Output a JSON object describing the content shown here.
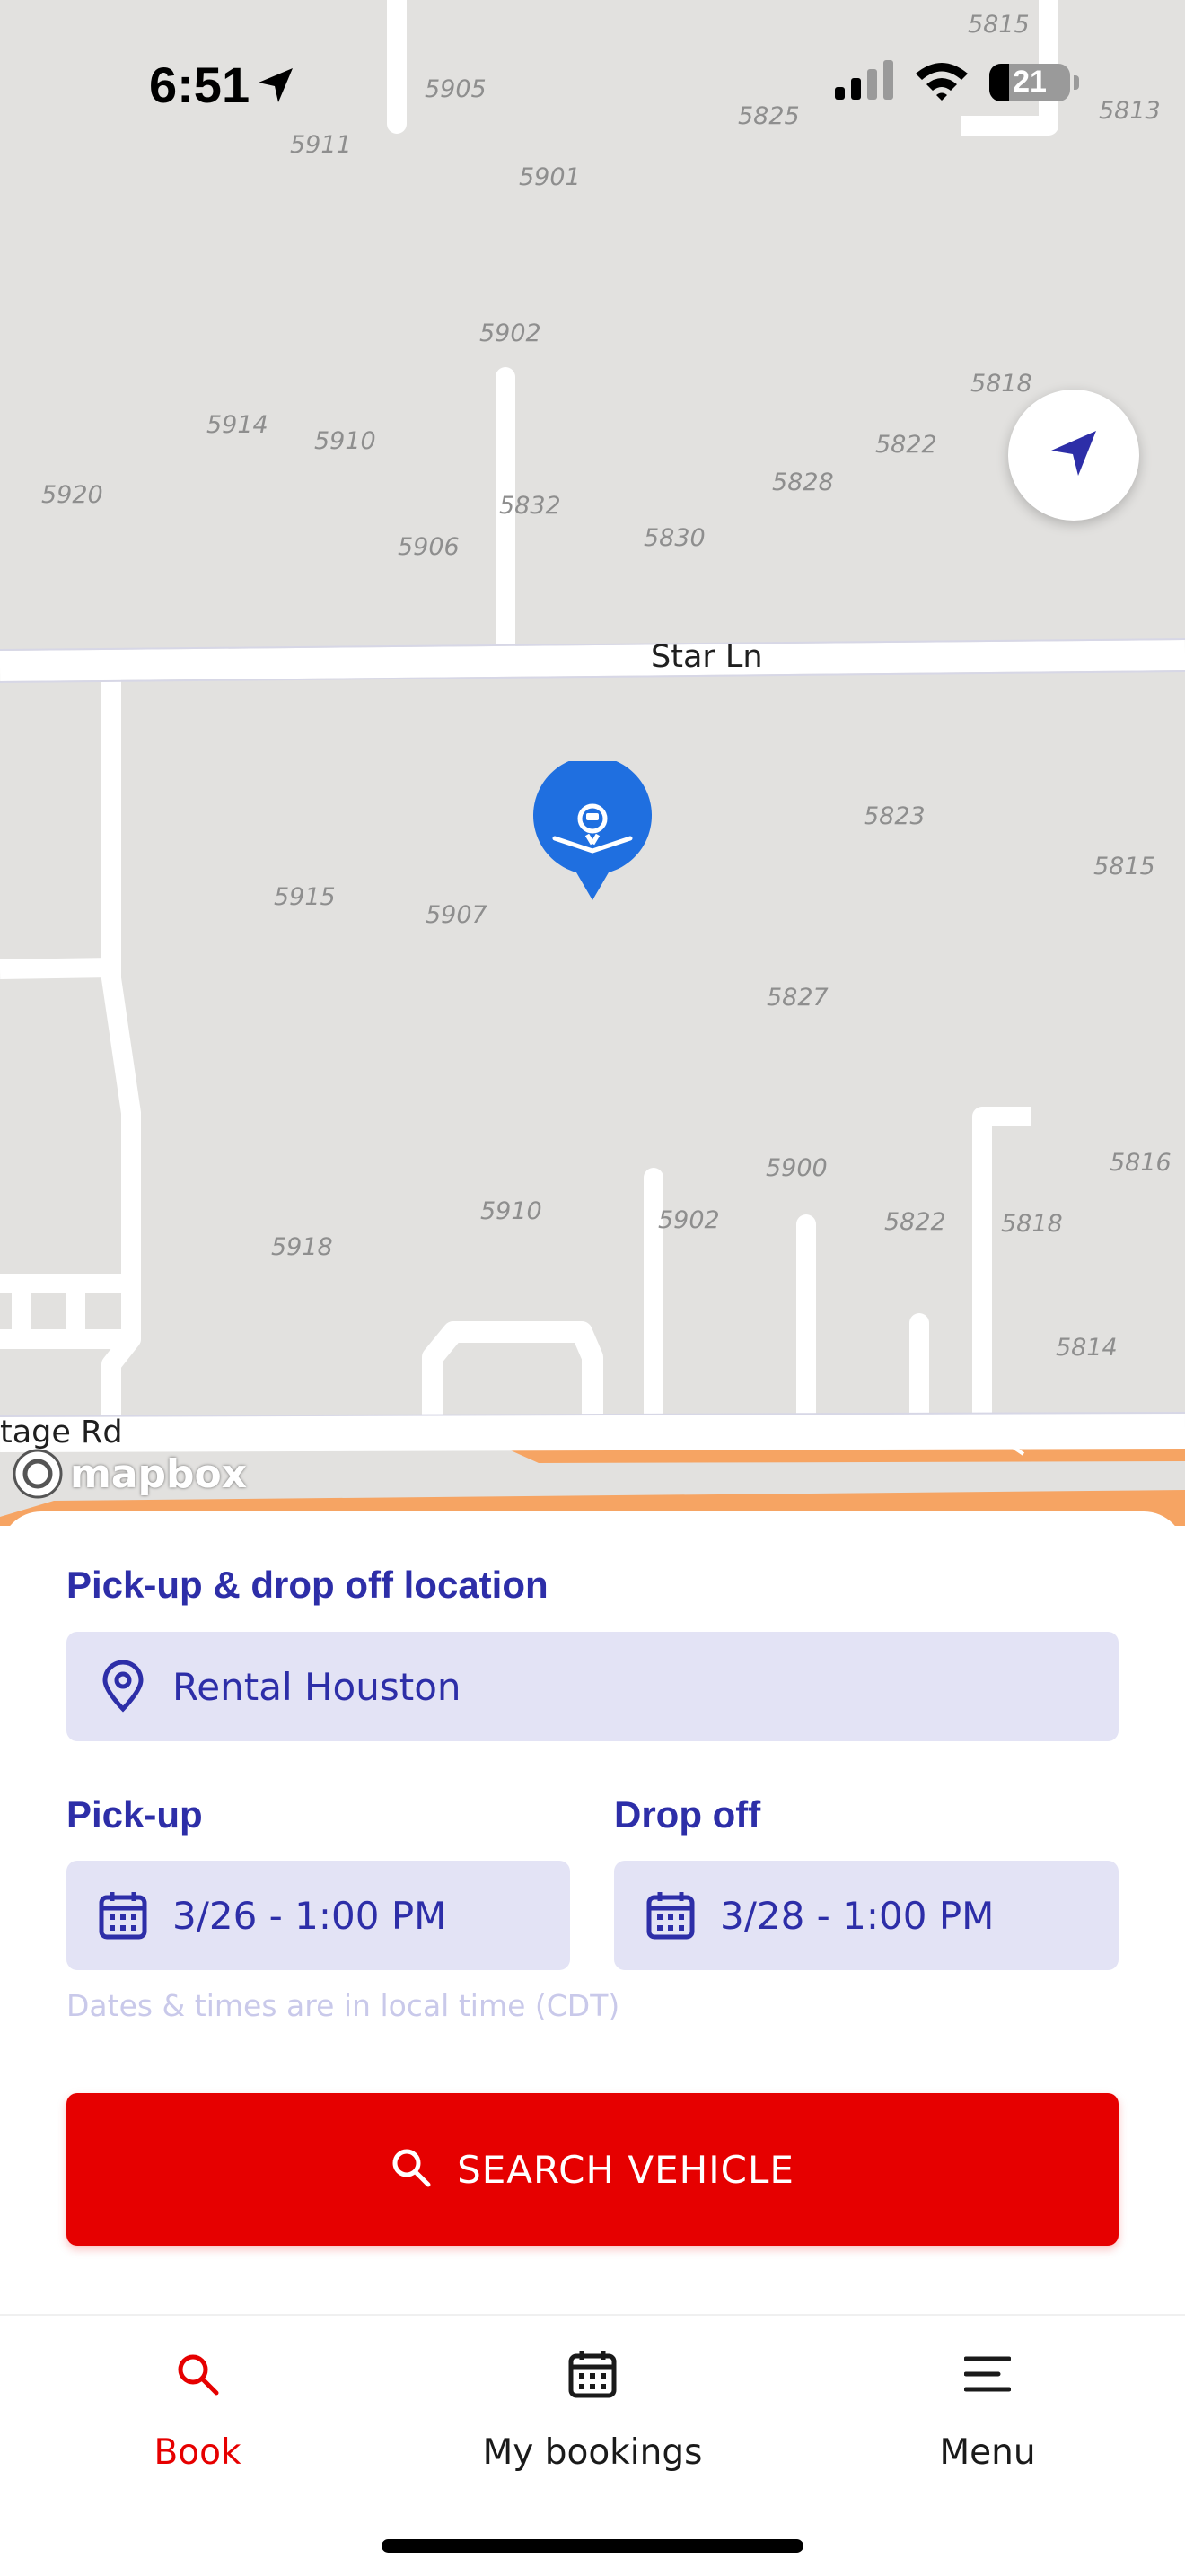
{
  "status_bar": {
    "time": "6:51",
    "battery_level": "21",
    "icons": [
      "location-arrow-icon",
      "cellular-signal-icon",
      "wifi-icon",
      "battery-icon"
    ]
  },
  "map": {
    "provider_logo": "mapbox",
    "streets": [
      "Star Ln",
      "tage Rd"
    ],
    "address_labels": [
      "5815",
      "5905",
      "5825",
      "5813",
      "5911",
      "5901",
      "5902",
      "5818",
      "5914",
      "5910",
      "5822",
      "5920",
      "5828",
      "5832",
      "5906",
      "5830",
      "5823",
      "5815",
      "5915",
      "5907",
      "5827",
      "5900",
      "5816",
      "5910",
      "5902",
      "5822",
      "5818",
      "5918",
      "5814"
    ],
    "marker_icon": "car-rental-pin-icon",
    "locate_button_icon": "navigation-arrow-icon"
  },
  "booking": {
    "location_label": "Pick-up & drop off location",
    "location_value": "Rental Houston",
    "pickup_label": "Pick-up",
    "pickup_value": "3/26 - 1:00 PM",
    "dropoff_label": "Drop off",
    "dropoff_value": "3/28 - 1:00 PM",
    "timezone_note": "Dates & times are in local time (CDT)",
    "search_button": "SEARCH VEHICLE"
  },
  "tabs": [
    {
      "label": "Book",
      "icon": "search-icon",
      "active": true
    },
    {
      "label": "My bookings",
      "icon": "calendar-icon",
      "active": false
    },
    {
      "label": "Menu",
      "icon": "menu-icon",
      "active": false
    }
  ],
  "colors": {
    "primary_text": "#2d2ea8",
    "field_background": "#e3e3f5",
    "accent_red": "#e60000",
    "map_marker": "#1f6fe0",
    "map_background": "#e2e1df",
    "road_orange": "#f6a463"
  }
}
